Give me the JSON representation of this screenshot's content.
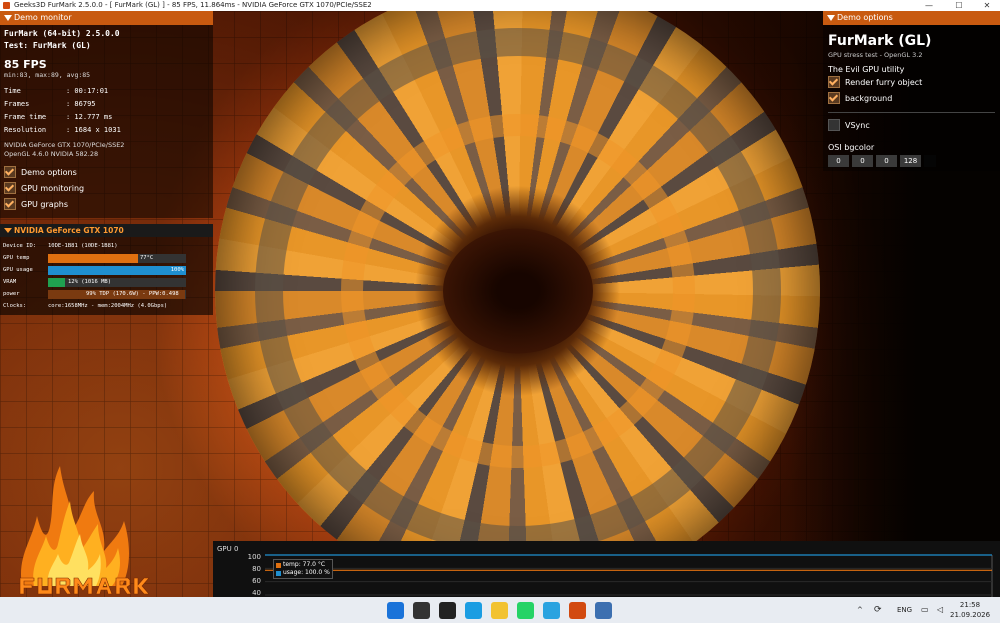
{
  "window": {
    "title": "Geeks3D FurMark 2.5.0.0 - [ FurMark (GL) ] - 85 FPS, 11.864ms - NVIDIA GeForce GTX 1070/PCIe/SSE2",
    "minimize": "—",
    "maximize": "☐",
    "close": "✕"
  },
  "demo_monitor": {
    "header": "Demo monitor",
    "app_line": "FurMark (64-bit) 2.5.0.0",
    "test_line": "Test: FurMark (GL)",
    "fps": "85 FPS",
    "fps_range": "min:83, max:89, avg:85",
    "stats": [
      {
        "key": "Time",
        "value": ": 00:17:01"
      },
      {
        "key": "Frames",
        "value": ": 86795"
      },
      {
        "key": "Frame time",
        "value": ": 12.777 ms"
      },
      {
        "key": "Resolution",
        "value": ": 1684 x 1031"
      }
    ],
    "renderer": "NVIDIA GeForce GTX 1070/PCIe/SSE2",
    "opengl": "OpenGL 4.6.0 NVIDIA 582.28",
    "options": [
      {
        "label": "Demo options",
        "checked": true
      },
      {
        "label": "GPU monitoring",
        "checked": true
      },
      {
        "label": "GPU graphs",
        "checked": true
      }
    ]
  },
  "gpu": {
    "header": "NVIDIA GeForce GTX 1070",
    "device_label": "Device ID:",
    "device_id": "10DE-1B81 (10DE-1B81)",
    "temp_label": "GPU temp",
    "temp_text": "77°C",
    "temp_pct": 0.65,
    "usage_label": "GPU usage",
    "usage_text": "100%",
    "usage_pct": 1.0,
    "vram_label": "VRAM",
    "vram_text": "12% (1016 MB)",
    "vram_pct": 0.12,
    "power_label": "power",
    "power_text": "99% TDP (170.6W) - PPW:0.498",
    "power_pct": 0.99,
    "clocks_label": "Clocks:",
    "clocks_text": "core:1658MHz - mem:2004MHz (4.0Gbps)",
    "colors": {
      "temp": "#e07010",
      "usage": "#1f8fd0",
      "vram": "#20a050",
      "power": "#7a3a10"
    }
  },
  "demo_options": {
    "header": "Demo options",
    "title": "FurMark (GL)",
    "subtitle": "GPU stress test - OpenGL 3.2",
    "evil_label": "The Evil GPU utility",
    "checks": [
      {
        "label": "Render furry object",
        "checked": true
      },
      {
        "label": "background",
        "checked": true
      }
    ],
    "vsync": {
      "label": "VSync",
      "checked": false
    },
    "osi_label": "OSI bgcolor",
    "osi_values": [
      "0",
      "0",
      "0",
      "128"
    ]
  },
  "graph": {
    "label": "GPU 0",
    "y_ticks": [
      "100",
      "80",
      "60",
      "40"
    ],
    "legend": [
      {
        "text": "temp: 77.0 °C",
        "color": "#e07010"
      },
      {
        "text": "usage: 100.0 %",
        "color": "#1f8fd0"
      }
    ],
    "temp_value": 77.0,
    "usage_value": 100.0
  },
  "taskbar": {
    "lang": "ENG",
    "time": "21:58",
    "date": "21.09.2026",
    "apps": [
      {
        "name": "start-icon",
        "color": "#1a73d9"
      },
      {
        "name": "search-icon",
        "color": "#333333"
      },
      {
        "name": "media-player-icon",
        "color": "#222222"
      },
      {
        "name": "edge-icon",
        "color": "#1b9de2"
      },
      {
        "name": "file-explorer-icon",
        "color": "#f2c230"
      },
      {
        "name": "whatsapp-icon",
        "color": "#25d366"
      },
      {
        "name": "telegram-icon",
        "color": "#2aa3e0"
      },
      {
        "name": "furmark-icon",
        "color": "#d24a10"
      },
      {
        "name": "app-icon",
        "color": "#3c6fb0"
      }
    ]
  }
}
